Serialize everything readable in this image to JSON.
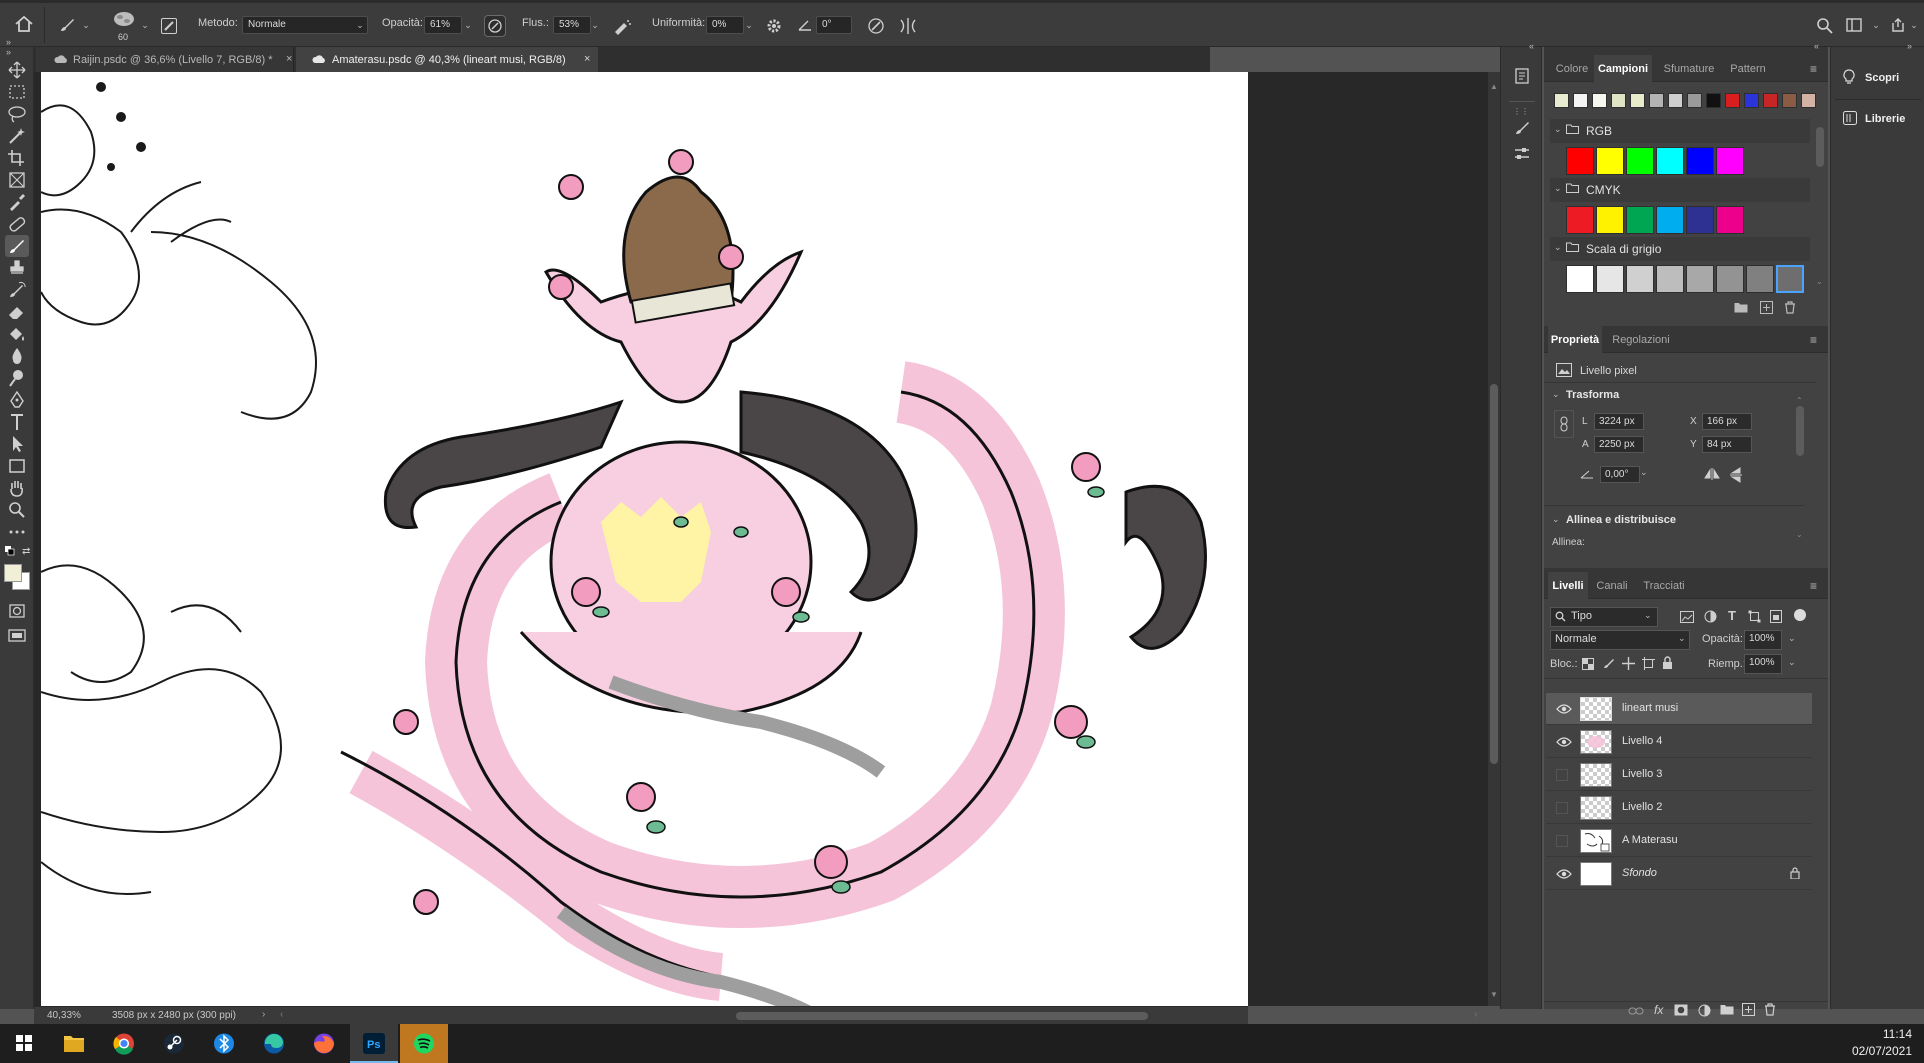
{
  "options_bar": {
    "brush_size": "60",
    "metodo_label": "Metodo:",
    "metodo_value": "Normale",
    "opacita_label": "Opacità:",
    "opacita_value": "61%",
    "flusso_label": "Flus.:",
    "flusso_value": "53%",
    "uniformita_label": "Uniformità:",
    "uniformita_value": "0%",
    "angle_value": "0°"
  },
  "tabs": [
    {
      "label": "Raijin.psdc @ 36,6% (Livello 7, RGB/8) *",
      "active": false
    },
    {
      "label": "Amaterasu.psdc @ 40,3% (lineart musi, RGB/8)",
      "active": true
    }
  ],
  "status_bar": {
    "zoom": "40,33%",
    "doc_info": "3508 px x 2480 px (300 ppi)"
  },
  "swatches_panel": {
    "tabs": [
      "Colore",
      "Campioni",
      "Sfumature",
      "Pattern"
    ],
    "active_tab": "Campioni",
    "recent_colors": [
      "#e9ebd1",
      "#f4f4f4",
      "#f7f7f0",
      "#dfe4c5",
      "#e8eccb",
      "#b3b3b3",
      "#cfcfcf",
      "#9a9a9a",
      "#111111",
      "#d81e1e",
      "#2b34d9",
      "#c82626",
      "#8b5b45",
      "#d3b1a5"
    ],
    "groups": [
      {
        "name": "RGB",
        "colors": [
          "#ff0000",
          "#ffff00",
          "#00ff00",
          "#00ffff",
          "#0000ff",
          "#ff00ff"
        ]
      },
      {
        "name": "CMYK",
        "colors": [
          "#ed1c24",
          "#fff200",
          "#00a651",
          "#00aeef",
          "#2e3192",
          "#ec008c"
        ]
      },
      {
        "name": "Scala di grigio",
        "colors": [
          "#ffffff",
          "#e6e6e6",
          "#d0d0d0",
          "#bdbdbd",
          "#a8a8a8",
          "#939393",
          "#808080",
          "#6e6e6e"
        ]
      }
    ]
  },
  "properties_panel": {
    "tabs": [
      "Proprietà",
      "Regolazioni"
    ],
    "active_tab": "Proprietà",
    "layer_type": "Livello pixel",
    "transform_title": "Trasforma",
    "l_label": "L",
    "l_value": "3224 px",
    "a_label": "A",
    "a_value": "2250 px",
    "x_label": "X",
    "x_value": "166 px",
    "y_label": "Y",
    "y_value": "84 px",
    "angle_value": "0,00°",
    "align_title": "Allinea e distribuisce",
    "align_label": "Allinea:"
  },
  "layers_panel": {
    "tabs": [
      "Livelli",
      "Canali",
      "Tracciati"
    ],
    "active_tab": "Livelli",
    "filter": "Tipo",
    "blend_mode": "Normale",
    "opacity_label": "Opacità:",
    "opacity_value": "100%",
    "lock_label": "Bloc.:",
    "fill_label": "Riemp.:",
    "fill_value": "100%",
    "layers": [
      {
        "name": "lineart musi",
        "visible": true,
        "selected": true
      },
      {
        "name": "Livello 4",
        "visible": true,
        "selected": false
      },
      {
        "name": "Livello 3",
        "visible": false,
        "selected": false
      },
      {
        "name": "Livello 2",
        "visible": false,
        "selected": false
      },
      {
        "name": "A Materasu",
        "visible": false,
        "selected": false
      },
      {
        "name": "Sfondo",
        "visible": true,
        "selected": false,
        "locked": true
      }
    ]
  },
  "side_panel": {
    "scopri": "Scopri",
    "librerie": "Librerie"
  },
  "taskbar": {
    "time": "11:14",
    "date": "02/07/2021"
  },
  "colors": {
    "foreground": "#f2efd8",
    "background": "#ffffff",
    "ps_blue": "#31a8ff",
    "spotify_green": "#1ed760"
  }
}
